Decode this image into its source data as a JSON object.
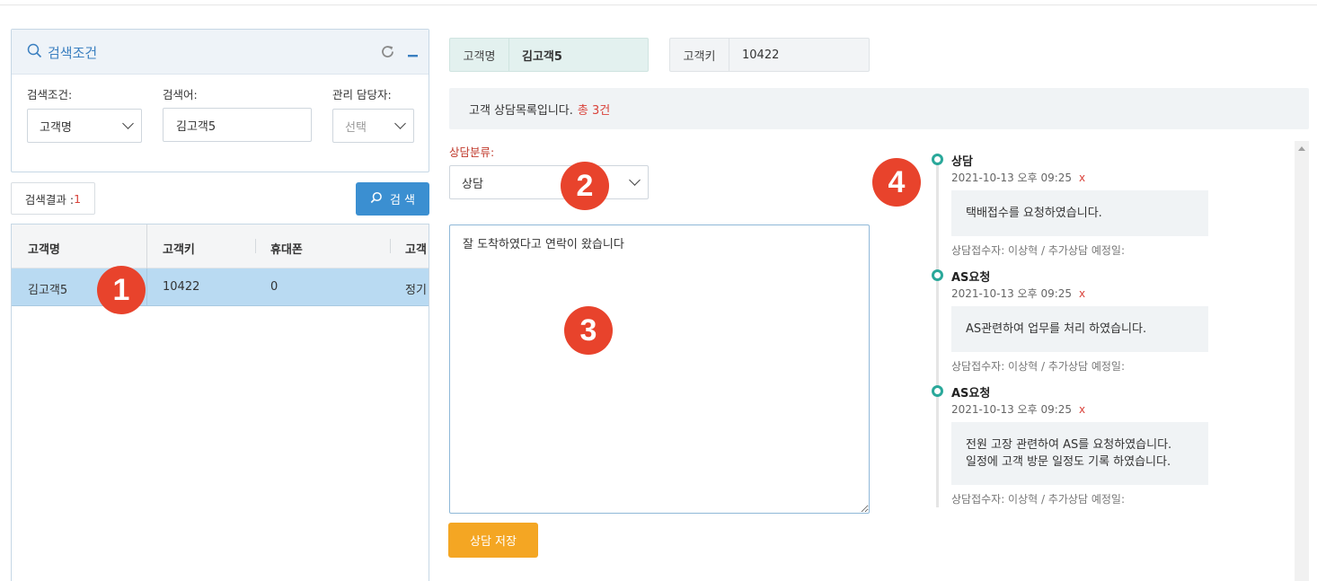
{
  "search_panel": {
    "title": "검색조건",
    "condition_label": "검색조건:",
    "condition_value": "고객명",
    "keyword_label": "검색어:",
    "keyword_value": "김고객5",
    "manager_label": "관리 담당자:",
    "manager_value": "선택"
  },
  "results": {
    "label": "검색결과 : ",
    "count": "1",
    "search_button": "검 색"
  },
  "grid": {
    "columns": [
      "고객명",
      "고객키",
      "휴대폰",
      "고객"
    ],
    "rows": [
      {
        "name": "김고객5",
        "key": "10422",
        "phone": "0",
        "type": "정기"
      }
    ]
  },
  "customer": {
    "name_label": "고객명",
    "name_value": "김고객5",
    "key_label": "고객키",
    "key_value": "10422"
  },
  "notice": {
    "text": "고객 상담목록입니다.",
    "total": "총 3건"
  },
  "consult_form": {
    "category_label": "상담분류:",
    "category_value": "상담",
    "memo": "잘 도착하였다고 연락이 왔습니다",
    "save_button": "상담 저장"
  },
  "markers": [
    "1",
    "2",
    "3",
    "4"
  ],
  "timeline": [
    {
      "title": "상담",
      "date": "2021-10-13 오후 09:25",
      "delete": "x",
      "body": [
        "택배접수를 요청하였습니다."
      ],
      "meta": "상담접수자: 이상혁 / 추가상담 예정일:"
    },
    {
      "title": "AS요청",
      "date": "2021-10-13 오후 09:25",
      "delete": "x",
      "body": [
        "AS관련하여 업무를 처리 하였습니다."
      ],
      "meta": "상담접수자: 이상혁 / 추가상담 예정일:"
    },
    {
      "title": "AS요청",
      "date": "2021-10-13 오후 09:25",
      "delete": "x",
      "body": [
        "전원 고장 관련하여 AS를 요청하였습니다.",
        "일정에 고객 방문 일정도 기록 하였습니다."
      ],
      "meta": "상담접수자: 이상혁 / 추가상담 예정일:"
    }
  ],
  "colors": {
    "primary": "#3b8fd1",
    "accent_red": "#d9423a",
    "save": "#f4a623",
    "timeline_dot": "#2aa89a",
    "marker": "#e8432c"
  }
}
